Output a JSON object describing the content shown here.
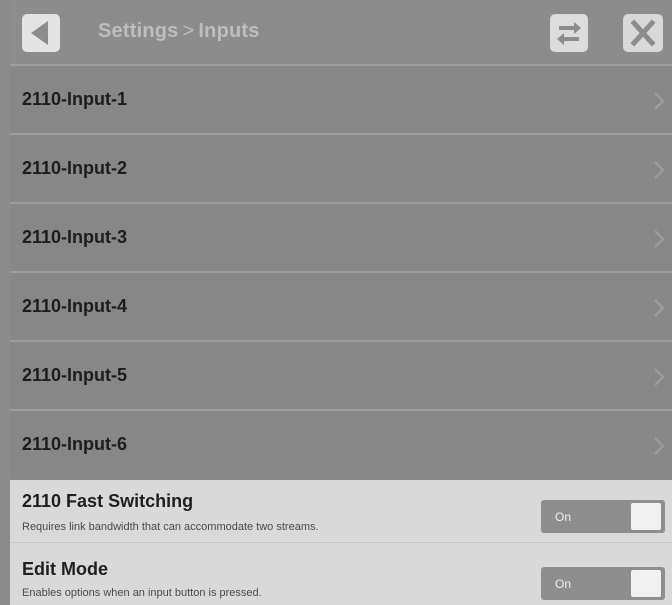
{
  "header": {
    "title_parent": "Settings",
    "title_separator": ">",
    "title_current": "Inputs",
    "icons": [
      "back-arrow-icon",
      "swap-icon",
      "close-icon"
    ]
  },
  "inputs": [
    {
      "label": "2110-Input-1"
    },
    {
      "label": "2110-Input-2"
    },
    {
      "label": "2110-Input-3"
    },
    {
      "label": "2110-Input-4"
    },
    {
      "label": "2110-Input-5"
    },
    {
      "label": "2110-Input-6"
    }
  ],
  "settings": {
    "fast_switching": {
      "title": "2110 Fast Switching",
      "description": "Requires link bandwidth that can accommodate two streams.",
      "toggle_label": "On"
    },
    "edit_mode": {
      "title": "Edit Mode",
      "description": "Enables options when an input button is pressed.",
      "toggle_label": "On"
    }
  },
  "colors": {
    "background": "#8a8a8a",
    "settings_panel": "#d9d9d9",
    "toggle_track": "#8e8e8e"
  }
}
